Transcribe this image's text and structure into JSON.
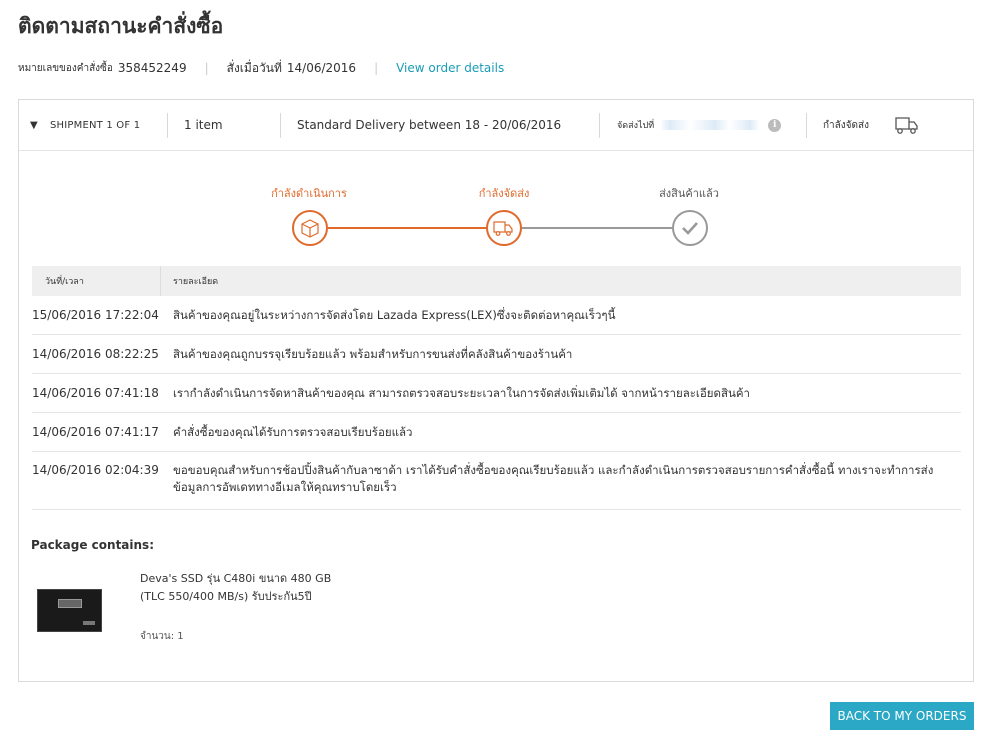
{
  "page": {
    "title": "ติดตามสถานะคำสั่งซื้อ"
  },
  "order": {
    "number_label": "หมายเลขของคำสั่งซื้อ",
    "number": "358452249",
    "date_label": "สั่งเมื่อวันที่",
    "date": "14/06/2016",
    "details_link": "View order details"
  },
  "shipment": {
    "toggle_icon": "▼",
    "label": "SHIPMENT 1 OF 1",
    "items": "1 item",
    "delivery": "Standard Delivery between 18 - 20/06/2016",
    "ship_to_label": "จัดส่งไปที่",
    "info_icon": "i",
    "status": "กำลังจัดส่ง"
  },
  "progress": {
    "steps": [
      {
        "label": "กำลังดำเนินการ",
        "state": "active",
        "icon": "box-icon"
      },
      {
        "label": "กำลังจัดส่ง",
        "state": "active",
        "icon": "truck-icon"
      },
      {
        "label": "ส่งสินค้าแล้ว",
        "state": "pending",
        "icon": "check-icon"
      }
    ],
    "colors": {
      "active": "#e06a2c",
      "pending": "#999999"
    }
  },
  "log": {
    "headers": {
      "datetime": "วันที่/เวลา",
      "detail": "รายละเอียด"
    },
    "rows": [
      {
        "datetime": "15/06/2016 17:22:04",
        "detail": "สินค้าของคุณอยู่ในระหว่างการจัดส่งโดย Lazada Express(LEX)ซึ่งจะติดต่อหาคุณเร็วๆนี้"
      },
      {
        "datetime": "14/06/2016 08:22:25",
        "detail": "สินค้าของคุณถูกบรรจุเรียบร้อยแล้ว พร้อมสำหรับการขนส่งที่คลังสินค้าของร้านค้า"
      },
      {
        "datetime": "14/06/2016 07:41:18",
        "detail": "เรากำลังดำเนินการจัดหาสินค้าของคุณ สามารถตรวจสอบระยะเวลาในการจัดส่งเพิ่มเติมได้ จากหน้ารายละเอียดสินค้า"
      },
      {
        "datetime": "14/06/2016 07:41:17",
        "detail": "คำสั่งซื้อของคุณได้รับการตรวจสอบเรียบร้อยแล้ว"
      },
      {
        "datetime": "14/06/2016 02:04:39",
        "detail": "ขอขอบคุณสำหรับการช้อปปิ้งสินค้ากับลาซาด้า เราได้รับคำสั่งซื้อของคุณเรียบร้อยแล้ว และกำลังดำเนินการตรวจสอบรายการคำสั่งซื้อนี้ ทางเราจะทำการส่งข้อมูลการอัพเดททางอีเมลให้คุณทราบโดยเร็ว"
      }
    ]
  },
  "package": {
    "title": "Package contains:",
    "item_name": "Deva's SSD รุ่น C480i ขนาด 480 GB (TLC 550/400 MB/s) รับประกัน5ปี",
    "qty": "จำนวน: 1"
  },
  "actions": {
    "back_label": "BACK TO MY ORDERS"
  }
}
